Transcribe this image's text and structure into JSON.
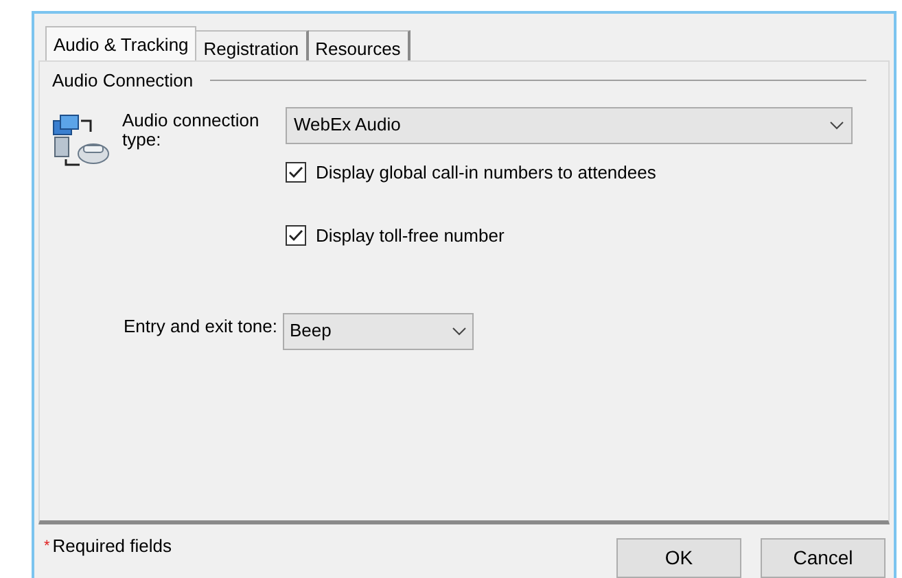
{
  "tabs": [
    {
      "label": "Audio & Tracking",
      "selected": true
    },
    {
      "label": "Registration",
      "selected": false
    },
    {
      "label": "Resources",
      "selected": false
    }
  ],
  "group": {
    "title": "Audio Connection"
  },
  "audio_type": {
    "label": "Audio connection type:",
    "value": "WebEx Audio"
  },
  "options": [
    {
      "label": "Display global call-in numbers to attendees",
      "checked": true
    },
    {
      "label": "Display toll-free number",
      "checked": true
    }
  ],
  "tone": {
    "label": "Entry and exit tone:",
    "value": "Beep"
  },
  "footer": {
    "required_mark": "*",
    "required_text": "Required fields"
  },
  "buttons": [
    "OK",
    "Cancel"
  ]
}
